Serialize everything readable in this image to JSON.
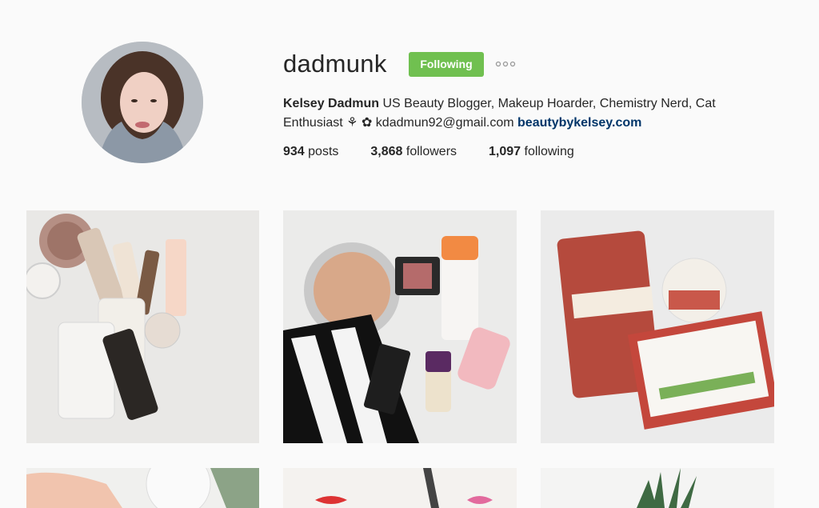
{
  "profile": {
    "username": "dadmunk",
    "follow_label": "Following",
    "full_name": "Kelsey Dadmun",
    "bio_text": " US Beauty Blogger, Makeup Hoarder, Chemistry Nerd, Cat Enthusiast ",
    "bio_symbols": "⚘ ✿",
    "email": " kdadmun92@gmail.com ",
    "website": "beautybykelsey.com"
  },
  "stats": {
    "posts_count": "934",
    "posts_label": " posts",
    "followers_count": "3,868",
    "followers_label": " followers",
    "following_count": "1,097",
    "following_label": " following"
  },
  "colors": {
    "follow_button": "#70c050",
    "link": "#003569"
  },
  "posts": [
    {
      "alt": "makeup flatlay"
    },
    {
      "alt": "highlighter and foundation flatlay"
    },
    {
      "alt": "Mirakle Cream sample"
    },
    {
      "alt": "hand holding product"
    },
    {
      "alt": "illustration of face"
    },
    {
      "alt": "succulent plant"
    }
  ]
}
